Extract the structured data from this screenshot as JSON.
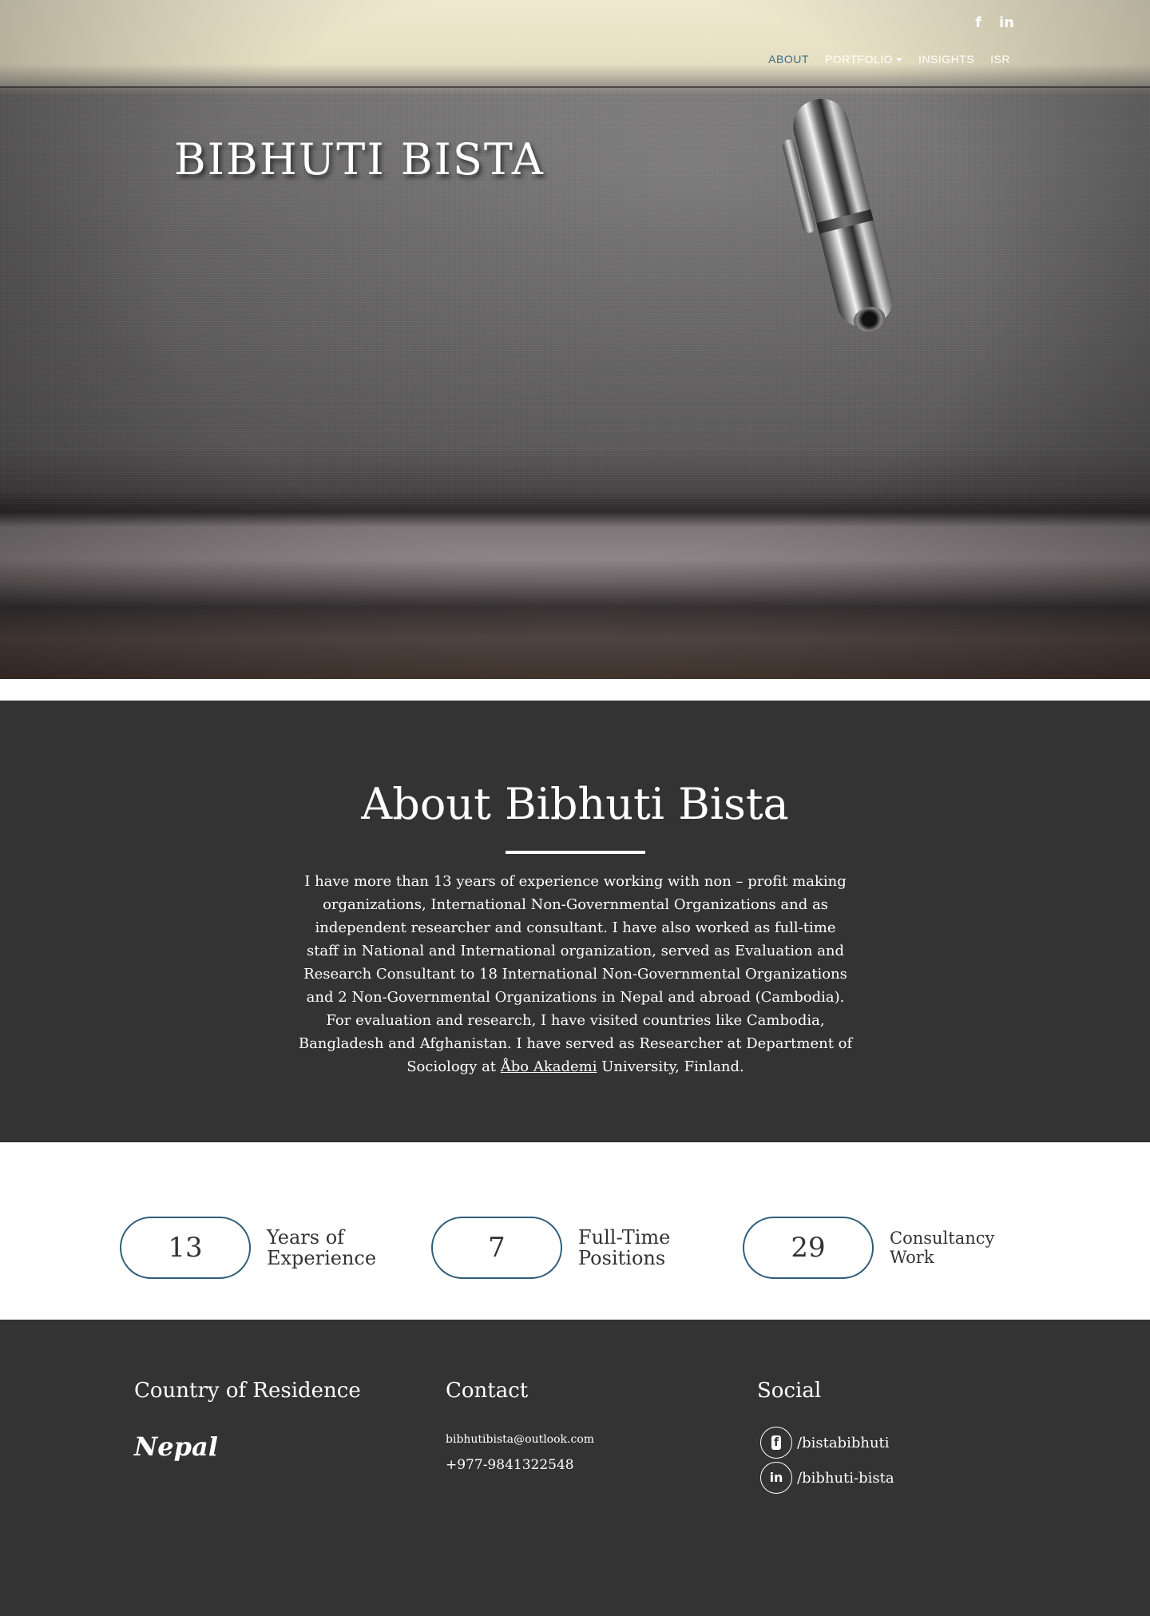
{
  "header": {
    "social_icons": [
      "facebook-icon",
      "linkedin-icon"
    ],
    "social_glyphs": {
      "facebook": "f",
      "linkedin": "in"
    },
    "nav": [
      {
        "label": "ABOUT",
        "active": true
      },
      {
        "label": "PORTFOLIO",
        "dropdown": true
      },
      {
        "label": "INSIGHTS"
      },
      {
        "label": "ISR"
      }
    ],
    "hero_title": "BIBHUTI BISTA"
  },
  "about": {
    "heading": "About Bibhuti Bista",
    "body_before_link": "I have more than 13 years of experience working with non – profit making organizations, International Non-Governmental Organizations and as independent researcher and consultant. I have also worked as full-time staff in National and International organization, served as Evaluation and Research Consultant to 18 International Non-Governmental Organizations and 2 Non-Governmental Organizations in Nepal and abroad (Cambodia). For evaluation and research, I have visited countries like Cambodia, Bangladesh and Afghanistan. I have served as Researcher at Department of Sociology at ",
    "link_text": "Åbo Akademi",
    "body_after_link": " University, Finland."
  },
  "stats": [
    {
      "value": "13",
      "label": "Years of Experience"
    },
    {
      "value": "7",
      "label": "Full-Time Positions"
    },
    {
      "value": "29",
      "label": "Consultancy Work"
    }
  ],
  "footer": {
    "residence": {
      "heading": "Country of Residence",
      "country": "Nepal"
    },
    "contact": {
      "heading": "Contact",
      "email": "bibhutibista@outlook.com",
      "phone": "+977-9841322548"
    },
    "social": {
      "heading": "Social",
      "facebook": "/bistabibhuti",
      "linkedin": "/bibhuti-bista"
    }
  },
  "colors": {
    "accent": "#3b6e86",
    "pill_border": "#2f5c78",
    "dark_bg": "#333333"
  }
}
